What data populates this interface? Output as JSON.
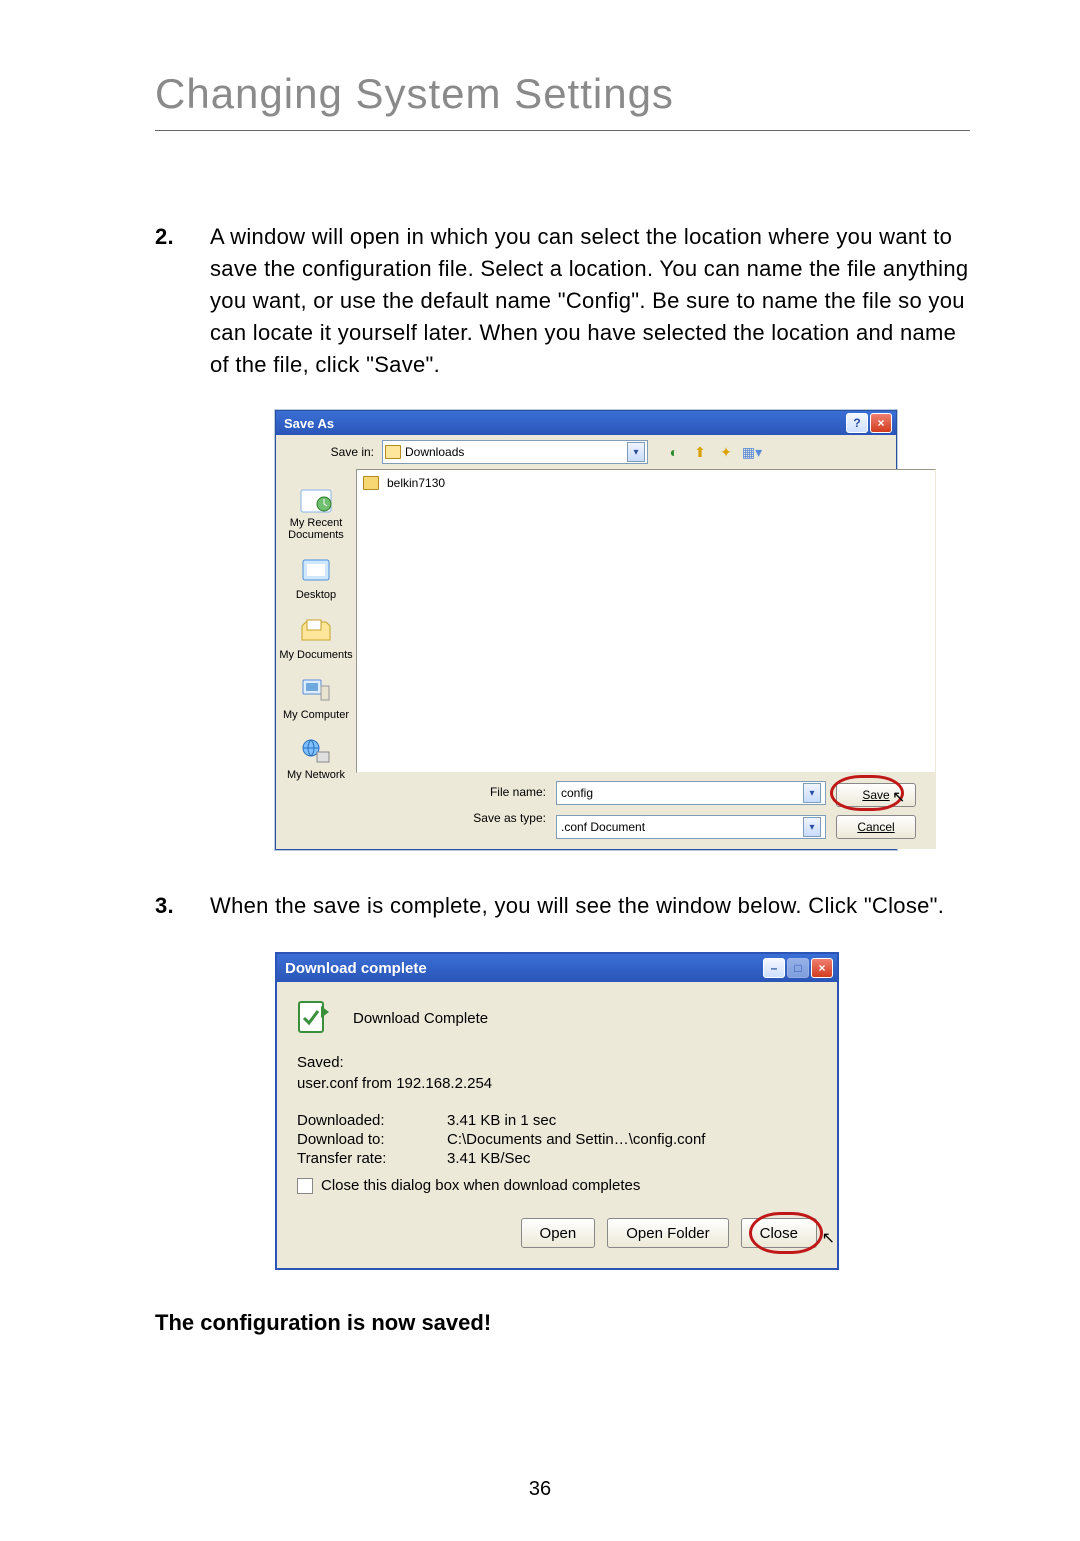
{
  "heading": "Changing System Settings",
  "steps": {
    "s2_num": "2.",
    "s2_text": "A window will open in which you can select the location where you want to save the configuration file. Select a location. You can name the file anything you want, or use the default name \"Config\". Be sure to name the file so you can locate it yourself later. When you have selected the location and name of the file, click \"Save\".",
    "s3_num": "3.",
    "s3_text": "When the save is complete, you will see the window below. Click \"Close\"."
  },
  "saveas": {
    "title": "Save As",
    "help": "?",
    "close": "×",
    "savein_label": "Save in:",
    "savein_value": "Downloads",
    "file_listed": "belkin7130",
    "places": {
      "recent": "My Recent Documents",
      "desktop": "Desktop",
      "mydocs": "My Documents",
      "mycomp": "My Computer",
      "mynet": "My Network"
    },
    "filename_label": "File name:",
    "filename_value": "config",
    "saveas_label": "Save as type:",
    "saveas_value": ".conf Document",
    "save_btn": "Save",
    "cancel_btn": "Cancel"
  },
  "download": {
    "title": "Download complete",
    "min": "–",
    "max": "□",
    "close": "×",
    "header": "Download Complete",
    "saved_label": "Saved:",
    "saved_value": "user.conf from 192.168.2.254",
    "stats": {
      "downloaded_label": "Downloaded:",
      "downloaded_value": "3.41 KB in 1 sec",
      "downloadto_label": "Download to:",
      "downloadto_value": "C:\\Documents and Settin…\\config.conf",
      "rate_label": "Transfer rate:",
      "rate_value": "3.41 KB/Sec"
    },
    "checkbox_label": "Close this dialog box when download completes",
    "open_btn": "Open",
    "openfolder_btn": "Open Folder",
    "close_btn": "Close"
  },
  "conf_saved": "The configuration is now saved!",
  "page_number": "36"
}
